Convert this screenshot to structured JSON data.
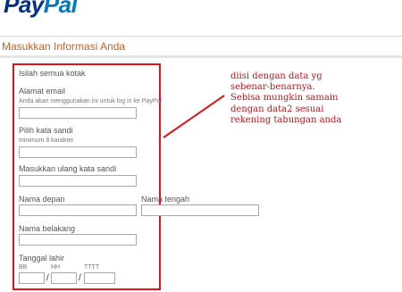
{
  "header": {
    "logo_pay": "Pay",
    "logo_pal": "Pal"
  },
  "section": {
    "title": "Masukkan Informasi Anda"
  },
  "form": {
    "intro": "Isilah semua kotak",
    "email": {
      "label": "Alamat email",
      "hint": "Anda akan menggunakan ini untuk log in ke PayPal",
      "value": ""
    },
    "password": {
      "label": "Pilih kata sandi",
      "hint": "minimum 8 karakter",
      "value": ""
    },
    "password_confirm": {
      "label": "Masukkan ulang kata sandi",
      "value": ""
    },
    "first_name": {
      "label": "Nama depan",
      "value": ""
    },
    "middle_name": {
      "label": "Nama tengah",
      "value": ""
    },
    "last_name": {
      "label": "Nama belakang",
      "value": ""
    },
    "dob": {
      "label": "Tanggal lahir",
      "day_label": "BB",
      "month_label": "HH",
      "year_label": "TTTT",
      "separator": "/"
    }
  },
  "annotation": {
    "lines": [
      "diisi dengan data yg",
      "sebenar-benarnya.",
      "Sebisa mungkin samain",
      "dengan data2 sesuai",
      "rekening tabungan anda"
    ],
    "color": "#c0141b"
  },
  "colors": {
    "highlight_box": "#e0151b",
    "section_title": "#c4642a",
    "logo_dark": "#003087",
    "logo_light": "#0079c1"
  }
}
